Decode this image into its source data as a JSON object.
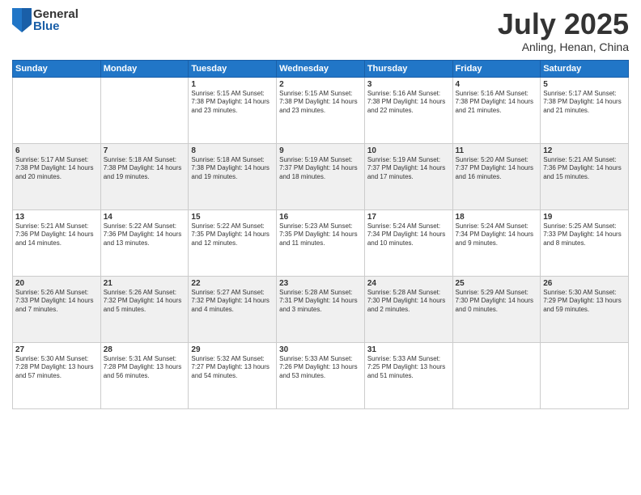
{
  "logo": {
    "general": "General",
    "blue": "Blue"
  },
  "title": "July 2025",
  "location": "Anling, Henan, China",
  "weekdays": [
    "Sunday",
    "Monday",
    "Tuesday",
    "Wednesday",
    "Thursday",
    "Friday",
    "Saturday"
  ],
  "weeks": [
    [
      {
        "day": "",
        "info": ""
      },
      {
        "day": "",
        "info": ""
      },
      {
        "day": "1",
        "info": "Sunrise: 5:15 AM\nSunset: 7:38 PM\nDaylight: 14 hours and 23 minutes."
      },
      {
        "day": "2",
        "info": "Sunrise: 5:15 AM\nSunset: 7:38 PM\nDaylight: 14 hours and 23 minutes."
      },
      {
        "day": "3",
        "info": "Sunrise: 5:16 AM\nSunset: 7:38 PM\nDaylight: 14 hours and 22 minutes."
      },
      {
        "day": "4",
        "info": "Sunrise: 5:16 AM\nSunset: 7:38 PM\nDaylight: 14 hours and 21 minutes."
      },
      {
        "day": "5",
        "info": "Sunrise: 5:17 AM\nSunset: 7:38 PM\nDaylight: 14 hours and 21 minutes."
      }
    ],
    [
      {
        "day": "6",
        "info": "Sunrise: 5:17 AM\nSunset: 7:38 PM\nDaylight: 14 hours and 20 minutes."
      },
      {
        "day": "7",
        "info": "Sunrise: 5:18 AM\nSunset: 7:38 PM\nDaylight: 14 hours and 19 minutes."
      },
      {
        "day": "8",
        "info": "Sunrise: 5:18 AM\nSunset: 7:38 PM\nDaylight: 14 hours and 19 minutes."
      },
      {
        "day": "9",
        "info": "Sunrise: 5:19 AM\nSunset: 7:37 PM\nDaylight: 14 hours and 18 minutes."
      },
      {
        "day": "10",
        "info": "Sunrise: 5:19 AM\nSunset: 7:37 PM\nDaylight: 14 hours and 17 minutes."
      },
      {
        "day": "11",
        "info": "Sunrise: 5:20 AM\nSunset: 7:37 PM\nDaylight: 14 hours and 16 minutes."
      },
      {
        "day": "12",
        "info": "Sunrise: 5:21 AM\nSunset: 7:36 PM\nDaylight: 14 hours and 15 minutes."
      }
    ],
    [
      {
        "day": "13",
        "info": "Sunrise: 5:21 AM\nSunset: 7:36 PM\nDaylight: 14 hours and 14 minutes."
      },
      {
        "day": "14",
        "info": "Sunrise: 5:22 AM\nSunset: 7:36 PM\nDaylight: 14 hours and 13 minutes."
      },
      {
        "day": "15",
        "info": "Sunrise: 5:22 AM\nSunset: 7:35 PM\nDaylight: 14 hours and 12 minutes."
      },
      {
        "day": "16",
        "info": "Sunrise: 5:23 AM\nSunset: 7:35 PM\nDaylight: 14 hours and 11 minutes."
      },
      {
        "day": "17",
        "info": "Sunrise: 5:24 AM\nSunset: 7:34 PM\nDaylight: 14 hours and 10 minutes."
      },
      {
        "day": "18",
        "info": "Sunrise: 5:24 AM\nSunset: 7:34 PM\nDaylight: 14 hours and 9 minutes."
      },
      {
        "day": "19",
        "info": "Sunrise: 5:25 AM\nSunset: 7:33 PM\nDaylight: 14 hours and 8 minutes."
      }
    ],
    [
      {
        "day": "20",
        "info": "Sunrise: 5:26 AM\nSunset: 7:33 PM\nDaylight: 14 hours and 7 minutes."
      },
      {
        "day": "21",
        "info": "Sunrise: 5:26 AM\nSunset: 7:32 PM\nDaylight: 14 hours and 5 minutes."
      },
      {
        "day": "22",
        "info": "Sunrise: 5:27 AM\nSunset: 7:32 PM\nDaylight: 14 hours and 4 minutes."
      },
      {
        "day": "23",
        "info": "Sunrise: 5:28 AM\nSunset: 7:31 PM\nDaylight: 14 hours and 3 minutes."
      },
      {
        "day": "24",
        "info": "Sunrise: 5:28 AM\nSunset: 7:30 PM\nDaylight: 14 hours and 2 minutes."
      },
      {
        "day": "25",
        "info": "Sunrise: 5:29 AM\nSunset: 7:30 PM\nDaylight: 14 hours and 0 minutes."
      },
      {
        "day": "26",
        "info": "Sunrise: 5:30 AM\nSunset: 7:29 PM\nDaylight: 13 hours and 59 minutes."
      }
    ],
    [
      {
        "day": "27",
        "info": "Sunrise: 5:30 AM\nSunset: 7:28 PM\nDaylight: 13 hours and 57 minutes."
      },
      {
        "day": "28",
        "info": "Sunrise: 5:31 AM\nSunset: 7:28 PM\nDaylight: 13 hours and 56 minutes."
      },
      {
        "day": "29",
        "info": "Sunrise: 5:32 AM\nSunset: 7:27 PM\nDaylight: 13 hours and 54 minutes."
      },
      {
        "day": "30",
        "info": "Sunrise: 5:33 AM\nSunset: 7:26 PM\nDaylight: 13 hours and 53 minutes."
      },
      {
        "day": "31",
        "info": "Sunrise: 5:33 AM\nSunset: 7:25 PM\nDaylight: 13 hours and 51 minutes."
      },
      {
        "day": "",
        "info": ""
      },
      {
        "day": "",
        "info": ""
      }
    ]
  ]
}
